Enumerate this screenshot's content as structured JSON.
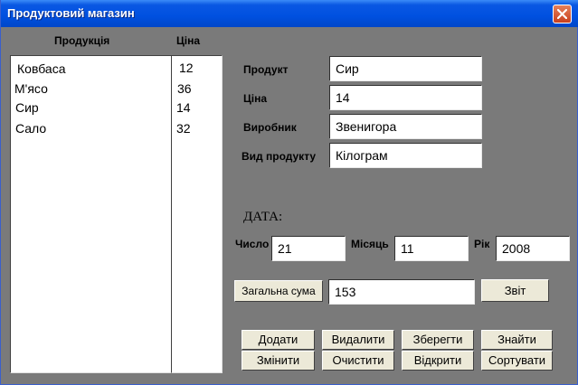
{
  "window": {
    "title": "Продуктовий магазин"
  },
  "list": {
    "header_product": "Продукція",
    "header_price": "Ціна",
    "products": [
      "Ковбаса",
      "М'ясо",
      "Сир",
      "Сало"
    ],
    "prices": [
      "12",
      "36",
      "14",
      "32"
    ]
  },
  "form": {
    "product_label": "Продукт",
    "product_value": "Сир",
    "price_label": "Ціна",
    "price_value": "14",
    "maker_label": "Виробник",
    "maker_value": "Звенигора",
    "kind_label": "Вид продукту",
    "kind_value": "Кілограм"
  },
  "date": {
    "heading": "ДАТА:",
    "day_label": "Число",
    "day_value": "21",
    "month_label": "Місяць",
    "month_value": "11",
    "year_label": "Рік",
    "year_value": "2008"
  },
  "total": {
    "button": "Загальна сума",
    "value": "153",
    "report_button": "Звіт"
  },
  "actions": {
    "add": "Додати",
    "delete": "Видалити",
    "save": "Зберегти",
    "find": "Знайти",
    "edit": "Змінити",
    "clear": "Очистити",
    "open": "Відкрити",
    "sort": "Сортувати"
  },
  "colors": {
    "titlebar": "#0050e0",
    "client": "#7a7a7a",
    "button_face": "#ece9d8"
  }
}
